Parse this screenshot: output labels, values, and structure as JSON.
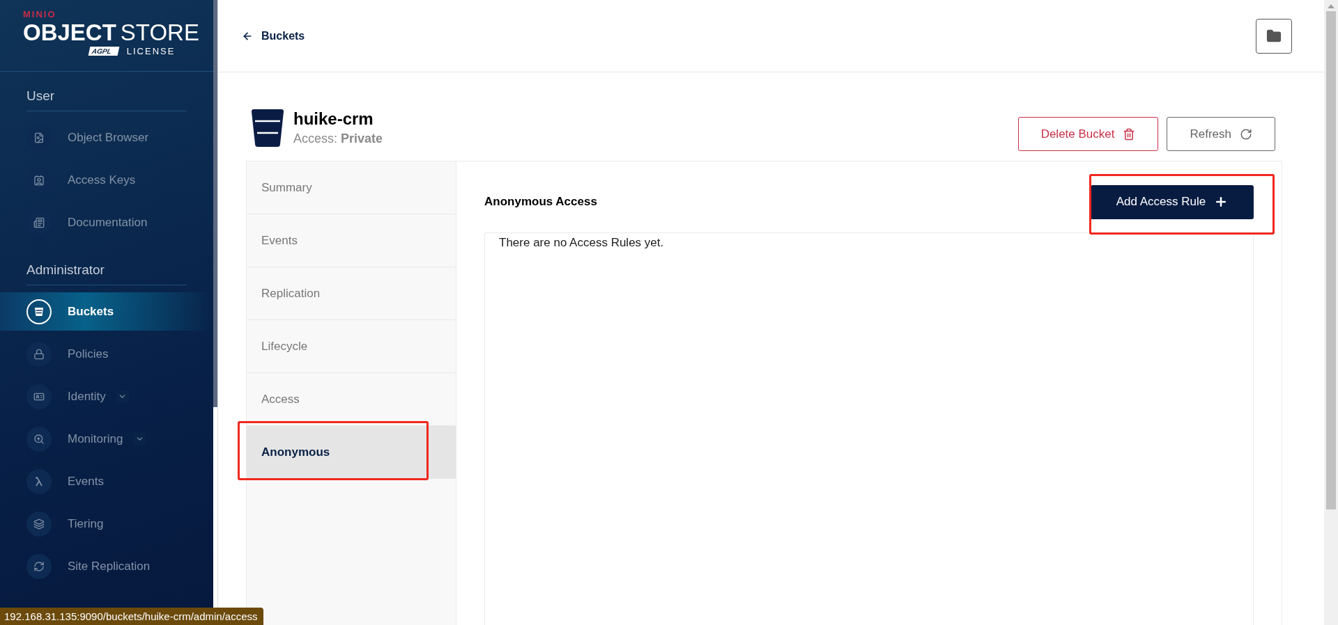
{
  "sidebar": {
    "logo": {
      "brand": "MINIO",
      "product_bold": "OBJECT",
      "product_light": "STORE",
      "badge": "AGPL",
      "license": "LICENSE"
    },
    "sections": [
      {
        "title": "User",
        "items": [
          {
            "label": "Object Browser",
            "selected": false
          },
          {
            "label": "Access Keys",
            "selected": false
          },
          {
            "label": "Documentation",
            "selected": false
          }
        ]
      },
      {
        "title": "Administrator",
        "items": [
          {
            "label": "Buckets",
            "selected": true
          },
          {
            "label": "Policies",
            "selected": false
          },
          {
            "label": "Identity",
            "selected": false,
            "expanded": false
          },
          {
            "label": "Monitoring",
            "selected": false,
            "expanded": false
          },
          {
            "label": "Events",
            "selected": false
          },
          {
            "label": "Tiering",
            "selected": false
          },
          {
            "label": "Site Replication",
            "selected": false
          }
        ]
      }
    ]
  },
  "header": {
    "back_link": "Buckets"
  },
  "bucket": {
    "name": "huike-crm",
    "access_label": "Access:",
    "access_value": "Private"
  },
  "actions": [
    {
      "kind": "danger",
      "label": "Delete Bucket"
    },
    {
      "kind": "refresh",
      "label": "Refresh"
    }
  ],
  "tabs": [
    {
      "label": "Summary",
      "selected": false
    },
    {
      "label": "Events",
      "selected": false
    },
    {
      "label": "Replication",
      "selected": false
    },
    {
      "label": "Lifecycle",
      "selected": false
    },
    {
      "label": "Access",
      "selected": false
    },
    {
      "label": "Anonymous",
      "selected": true
    }
  ],
  "panel": {
    "title": "Anonymous Access",
    "add_button": "Add Access Rule",
    "empty_message": "There are no Access Rules yet."
  },
  "status_bar": {
    "url": "192.168.31.135:9090/buckets/huike-crm/admin/access"
  }
}
